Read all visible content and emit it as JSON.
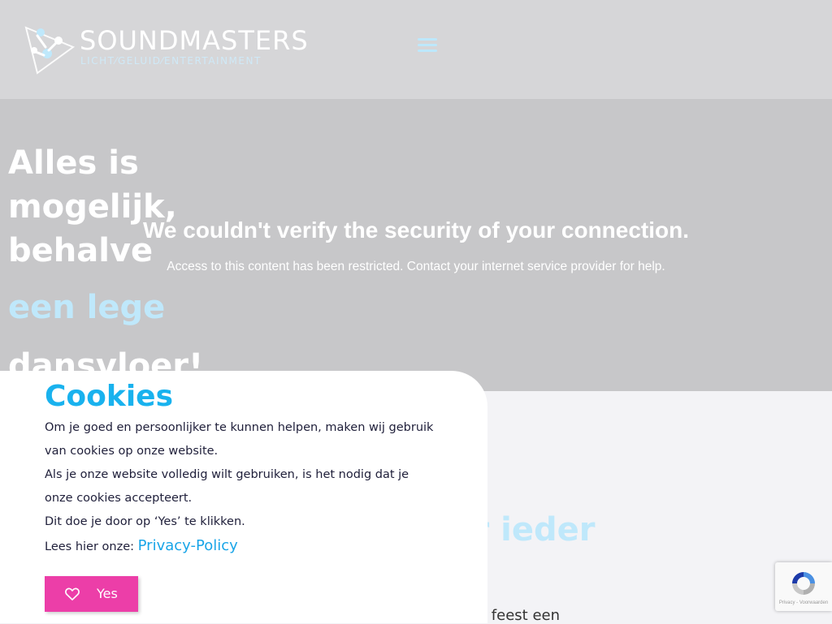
{
  "header": {
    "brand_name": "SOUNDMASTERS",
    "brand_tagline": "LICHT⁄GELUID⁄ENTERTAINMENT",
    "logo_icon": "soundmasters-logo-icon",
    "menu_icon": "hamburger-menu-icon"
  },
  "hero": {
    "headline_lines": [
      "Alles is",
      "mogelijk,",
      "behalve"
    ],
    "accent_text": "een lege",
    "tail_text": "dansvloer!"
  },
  "security_notice": {
    "title": "We couldn't verify the security of your connection.",
    "message": "Access to this content has been restricted. Contact your internet service provider for help."
  },
  "lower_section": {
    "heading_fragment": "or ieder",
    "text_fragment": "e feest een"
  },
  "cookie_banner": {
    "title": "Cookies",
    "paragraphs": [
      "Om je goed en persoonlijker te kunnen helpen, maken wij gebruik van cookies op onze website.",
      "Als je onze website volledig wilt gebruiken, is het nodig dat je onze cookies accepteert.",
      "Dit doe je door op ‘Yes’ te klikken."
    ],
    "privacy_prefix": "Lees hier onze: ",
    "privacy_link": "Privacy-Policy",
    "accept_button": "Yes",
    "accept_icon": "heart-icon"
  },
  "recaptcha": {
    "icon": "recaptcha-icon",
    "text": "Privacy - Voorwaarden"
  },
  "colors": {
    "accent_blue": "#19b2ee",
    "accent_pink": "#ec3ea8",
    "light_blue": "#bfe8fb"
  }
}
